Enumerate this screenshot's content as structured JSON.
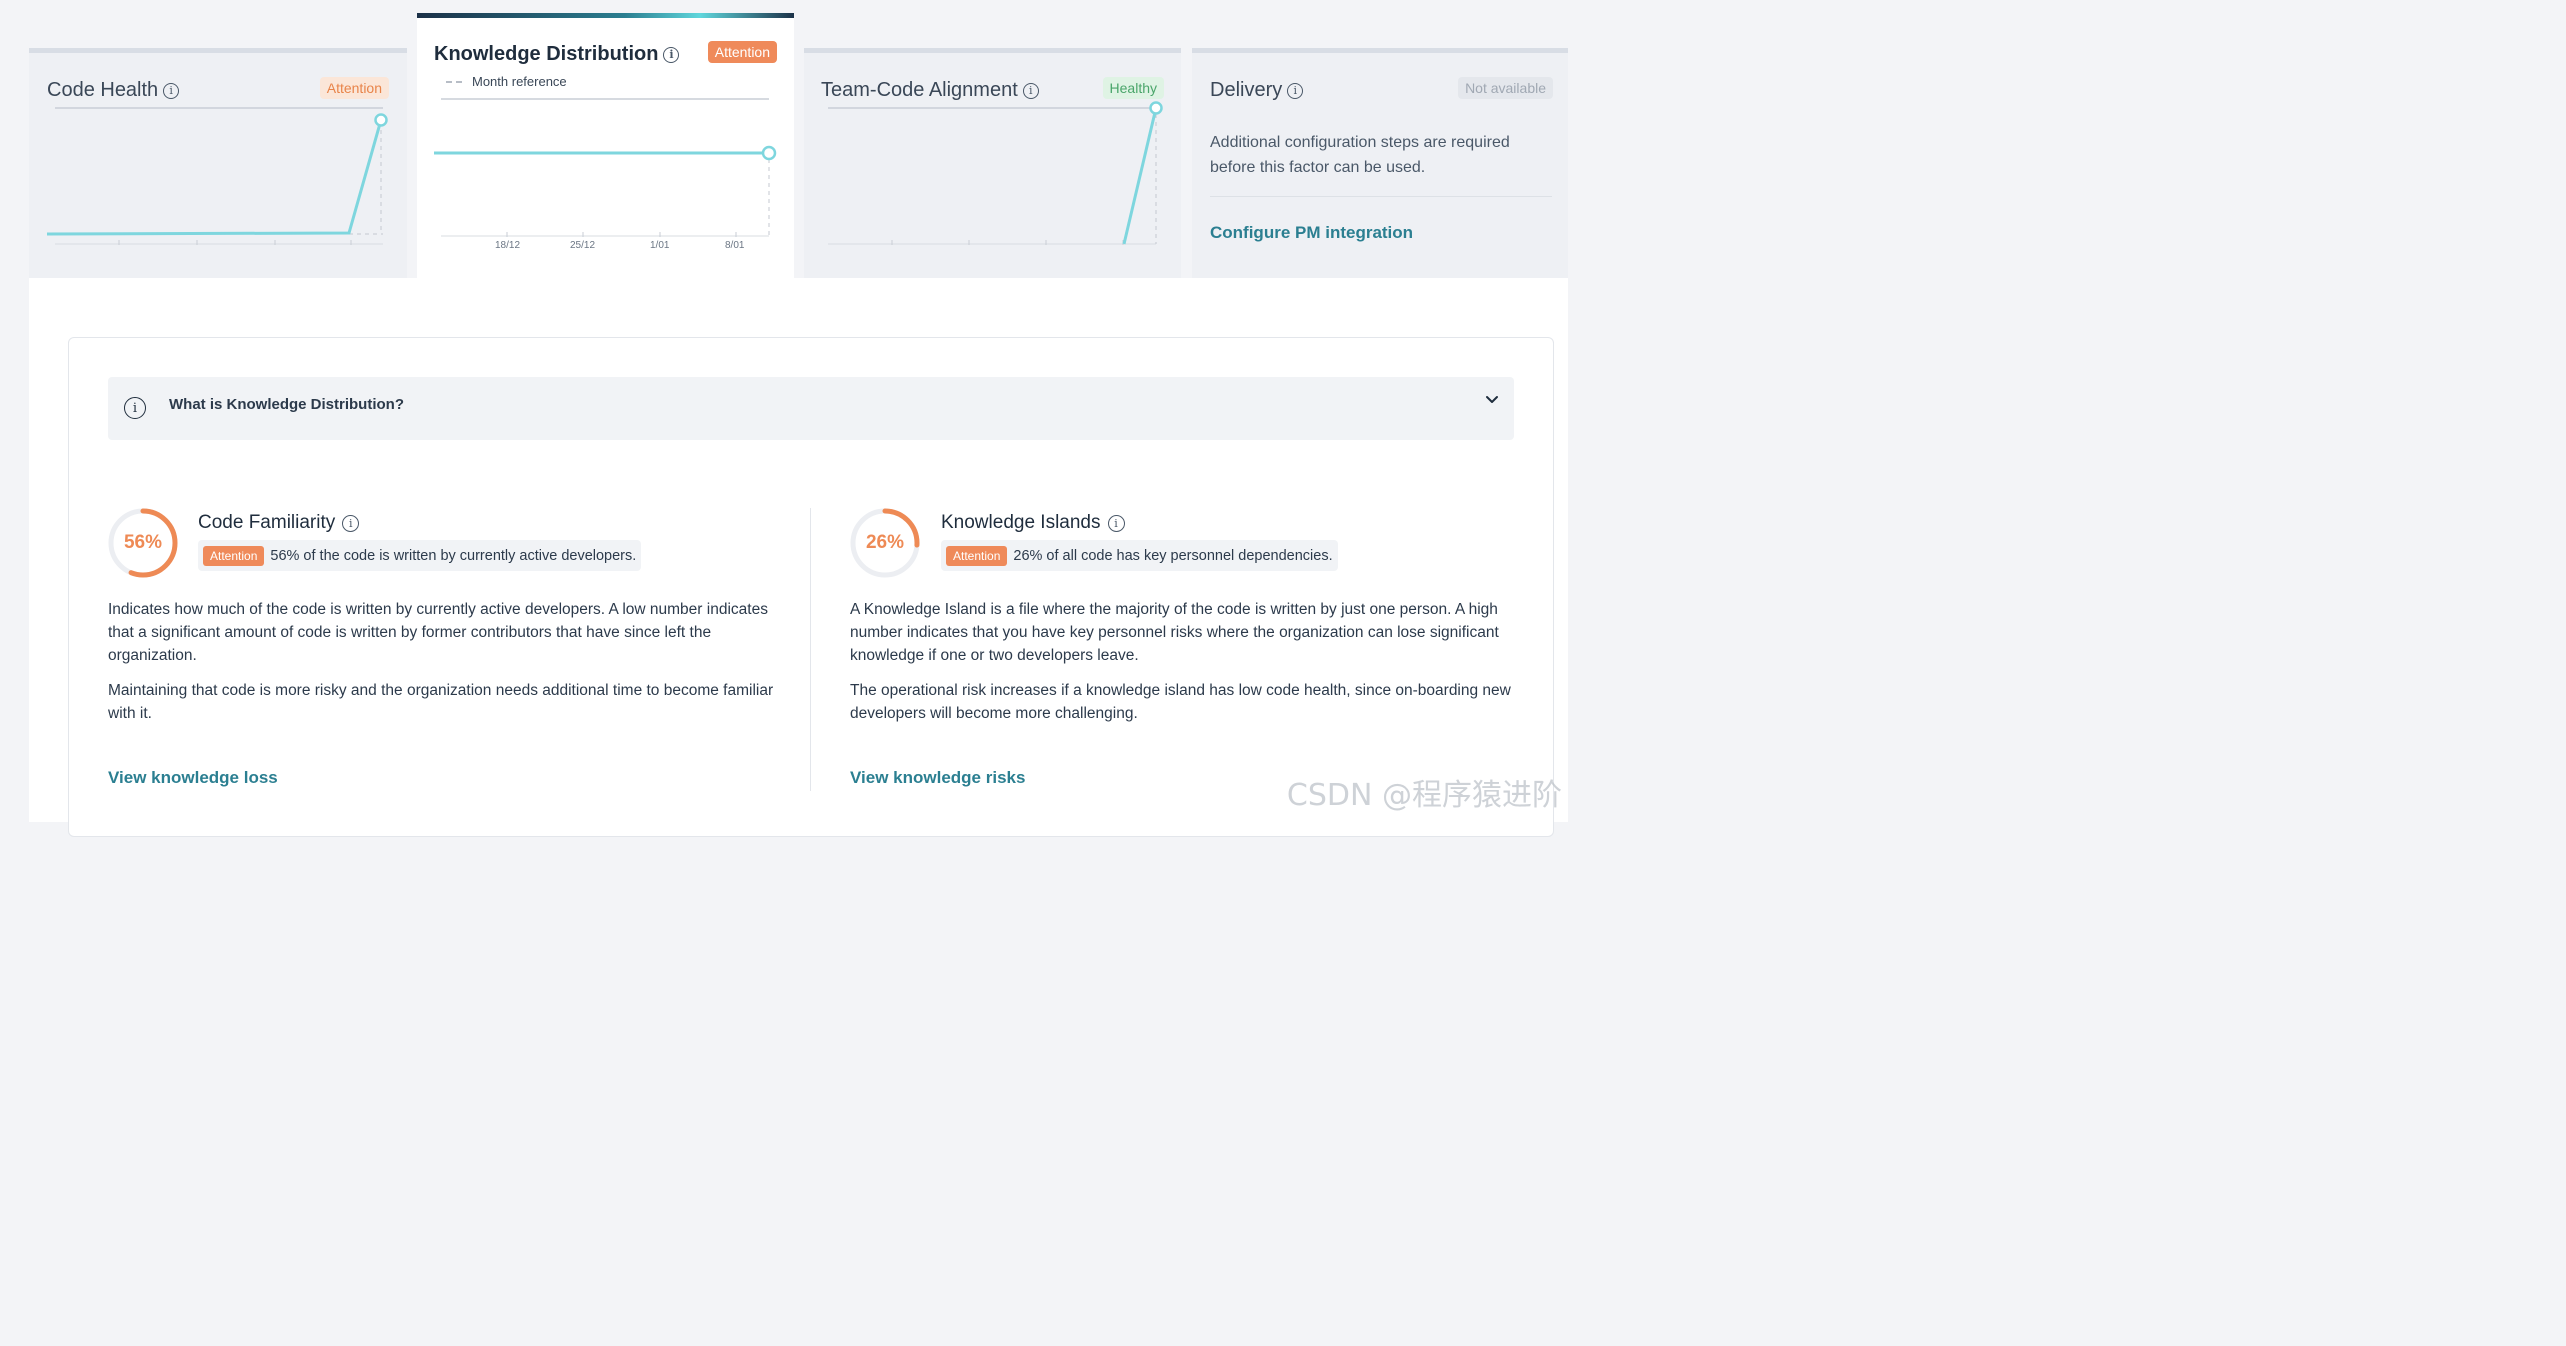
{
  "factors": {
    "code_health": {
      "title": "Code Health",
      "status": "Attention"
    },
    "knowledge_distribution": {
      "title": "Knowledge Distribution",
      "status": "Attention",
      "legend": "Month reference",
      "ticks": [
        "18/12",
        "25/12",
        "1/01",
        "8/01"
      ]
    },
    "team_code_alignment": {
      "title": "Team-Code Alignment",
      "status": "Healthy"
    },
    "delivery": {
      "title": "Delivery",
      "status": "Not available",
      "description": "Additional configuration steps are required before this factor can be used.",
      "link": "Configure PM integration"
    }
  },
  "accordion": {
    "title": "What is Knowledge Distribution?"
  },
  "metrics": {
    "code_familiarity": {
      "value_label": "56%",
      "fraction": 0.56,
      "title": "Code Familiarity",
      "badge": "Attention",
      "summary": "56% of the code is written by currently active developers.",
      "para1": "Indicates how much of the code is written by currently active developers. A low number indicates that a significant amount of code is written by former contributors that have since left the organization.",
      "para2": "Maintaining that code is more risky and the organization needs additional time to become familiar with it.",
      "link": "View knowledge loss"
    },
    "knowledge_islands": {
      "value_label": "26%",
      "fraction": 0.26,
      "title": "Knowledge Islands",
      "badge": "Attention",
      "summary": "26% of all code has key personnel dependencies.",
      "para1": "A Knowledge Island is a file where the majority of the code is written by just one person. A high number indicates that you have key personnel risks where the organization can lose significant knowledge if one or two developers leave.",
      "para2": "The operational risk increases if a knowledge island has low code health, since on-boarding new developers will become more challenging.",
      "link": "View knowledge risks"
    }
  },
  "watermark": "CSDN @程序猿进阶",
  "colors": {
    "accent": "#2b7f91",
    "line": "#7ed6de",
    "attention": "#ef8a5a",
    "healthy": "#4aa56a"
  }
}
